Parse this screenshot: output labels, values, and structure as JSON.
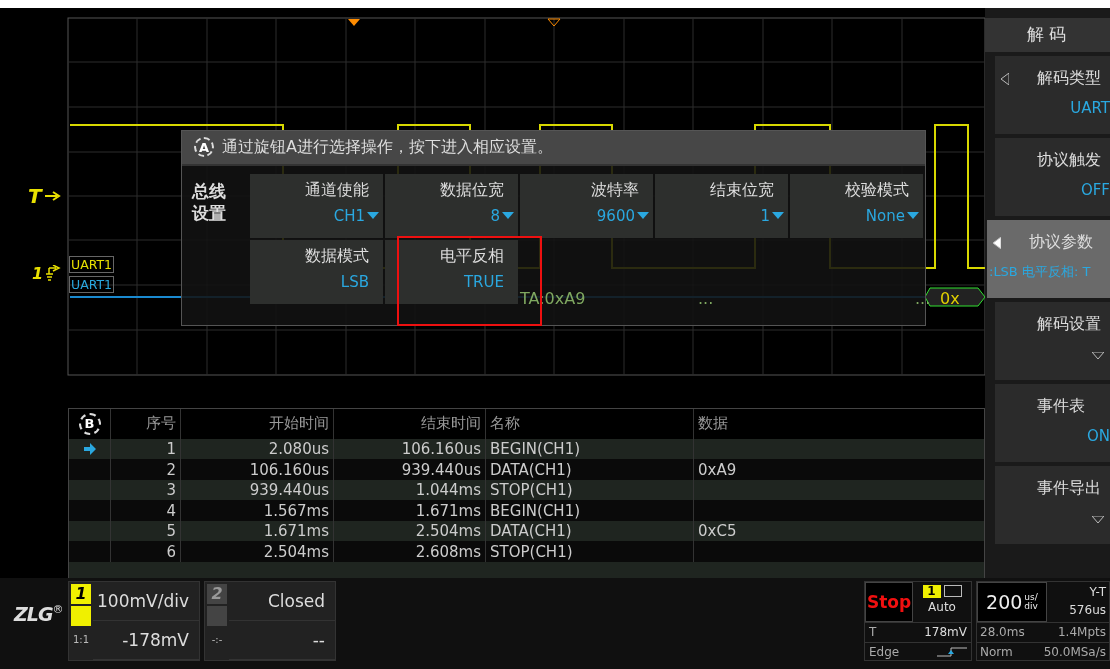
{
  "scope": {
    "trigger_label": "T",
    "channel_label": "1",
    "bus_labels": [
      "UART1",
      "UART1"
    ],
    "bus_segments": [
      {
        "text": "TA:0xA9",
        "faded": true
      },
      {
        "text": "...",
        "faded": true
      },
      {
        "text": "...",
        "faded": true
      },
      {
        "text": "0x",
        "faded": false
      }
    ]
  },
  "popup": {
    "knob": "A",
    "hint": "通过旋钮A进行选择操作，按下进入相应设置。",
    "section": [
      "总线",
      "设置"
    ],
    "cells": [
      {
        "label": "通道使能",
        "value": "CH1",
        "dropdown": true,
        "highlighted": false
      },
      {
        "label": "数据位宽",
        "value": "8",
        "dropdown": true,
        "highlighted": false
      },
      {
        "label": "波特率",
        "value": "9600",
        "dropdown": true,
        "highlighted": false
      },
      {
        "label": "结束位宽",
        "value": "1",
        "dropdown": true,
        "highlighted": false
      },
      {
        "label": "校验模式",
        "value": "None",
        "dropdown": true,
        "highlighted": false
      },
      {
        "label": "数据模式",
        "value": "LSB",
        "dropdown": false,
        "highlighted": false
      },
      {
        "label": "电平反相",
        "value": "TRUE",
        "dropdown": false,
        "highlighted": true
      }
    ]
  },
  "menu": {
    "title": "解 码",
    "items": [
      {
        "kind": "option",
        "label": "解码类型",
        "value": "UART",
        "selected": false
      },
      {
        "kind": "toggle",
        "label": "协议触发",
        "value": "OFF",
        "selected": false
      },
      {
        "kind": "option",
        "label": "协议参数",
        "value": ":LSB 电平反相: T",
        "selected": true
      },
      {
        "kind": "submenu",
        "label": "解码设置",
        "selected": false
      },
      {
        "kind": "toggle",
        "label": "事件表",
        "value": "ON",
        "selected": false
      },
      {
        "kind": "submenu",
        "label": "事件导出",
        "selected": false
      }
    ]
  },
  "table": {
    "knob": "B",
    "columns": [
      "序号",
      "开始时间",
      "结束时间",
      "名称",
      "数据"
    ],
    "rows": [
      {
        "cells": [
          "1",
          "2.080us",
          "106.160us",
          "BEGIN(CH1)",
          ""
        ],
        "current": true
      },
      {
        "cells": [
          "2",
          "106.160us",
          "939.440us",
          "DATA(CH1)",
          "0xA9"
        ],
        "current": false
      },
      {
        "cells": [
          "3",
          "939.440us",
          "1.044ms",
          "STOP(CH1)",
          ""
        ],
        "current": false
      },
      {
        "cells": [
          "4",
          "1.567ms",
          "1.671ms",
          "BEGIN(CH1)",
          ""
        ],
        "current": false
      },
      {
        "cells": [
          "5",
          "1.671ms",
          "2.504ms",
          "DATA(CH1)",
          "0xC5"
        ],
        "current": false
      },
      {
        "cells": [
          "6",
          "2.504ms",
          "2.608ms",
          "STOP(CH1)",
          ""
        ],
        "current": false
      }
    ]
  },
  "status": {
    "logo": "ZLG",
    "logo_mark": "®",
    "channels": [
      {
        "number": "1",
        "on": true,
        "scale": "100mV/div",
        "offset": "-178mV",
        "probe": "1:1"
      },
      {
        "number": "2",
        "on": false,
        "scale": "Closed",
        "offset": "--",
        "probe": "-:-"
      }
    ],
    "run_state": "Stop",
    "trigger": {
      "source": "1",
      "mode": "Auto",
      "type_label": "T",
      "level": "178mV",
      "kind": "Edge"
    },
    "timebase": {
      "value": "200",
      "unit": "us/\ndiv",
      "mode": "Y-T",
      "delay": "576us",
      "span": "28.0ms",
      "depth": "1.4Mpts",
      "acq": "Norm",
      "rate": "50.0MSa/s"
    }
  }
}
